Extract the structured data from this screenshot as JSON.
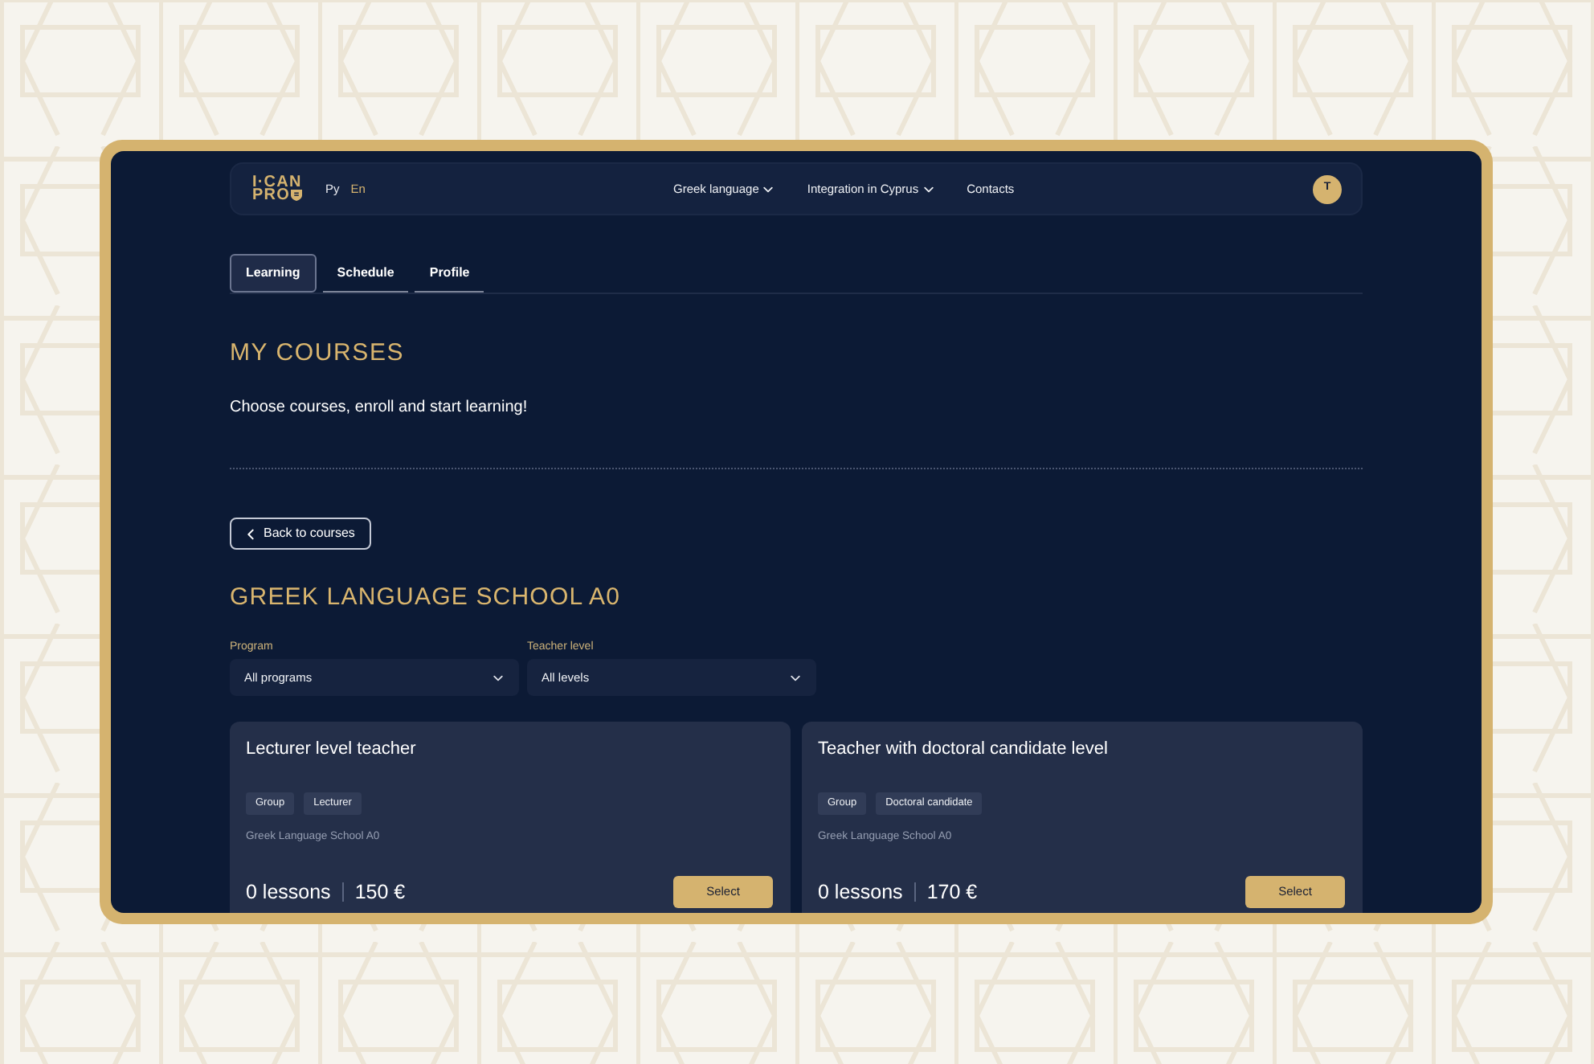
{
  "logo": {
    "line_1": "I·CAN",
    "line_2": "PRO"
  },
  "languages": [
    {
      "label": "Ру",
      "selected": false
    },
    {
      "label": "En",
      "selected": true
    }
  ],
  "nav": [
    {
      "label": "Greek language",
      "has_dropdown": true
    },
    {
      "label": "Integration in Cyprus",
      "has_dropdown": true
    },
    {
      "label": "Contacts",
      "has_dropdown": false
    }
  ],
  "avatar": {
    "initial": "T"
  },
  "tabs": [
    {
      "label": "Learning",
      "selected": true
    },
    {
      "label": "Schedule",
      "selected": false
    },
    {
      "label": "Profile",
      "selected": false
    }
  ],
  "page_title": "MY COURSES",
  "page_subtitle": "Choose courses, enroll and start learning!",
  "back_button": "Back to courses",
  "course_title": "GREEK LANGUAGE SCHOOL A0",
  "filters": [
    {
      "label": "Program",
      "value": "All programs"
    },
    {
      "label": "Teacher level",
      "value": "All levels"
    }
  ],
  "cards": [
    {
      "title": "Lecturer level teacher",
      "tags": [
        "Group",
        "Lecturer"
      ],
      "school": "Greek Language School A0",
      "lessons": "0 lessons",
      "price": "150 €",
      "button": "Select"
    },
    {
      "title": "Teacher with doctoral candidate level",
      "tags": [
        "Group",
        "Doctoral candidate"
      ],
      "school": "Greek Language School A0",
      "lessons": "0 lessons",
      "price": "170 €",
      "button": "Select"
    }
  ]
}
